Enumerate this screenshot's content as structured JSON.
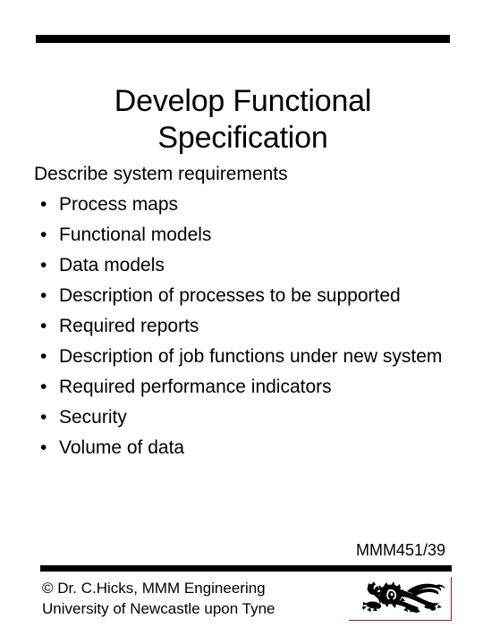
{
  "slide": {
    "title_lines": [
      "Develop Functional",
      "Specification"
    ],
    "lead": "Describe system requirements",
    "bullet_marker": "•",
    "bullets": [
      "Process maps",
      "Functional models",
      "Data models",
      "Description of processes to be supported",
      "Required reports",
      "Description of job functions under new system",
      "Required performance indicators",
      "Security",
      "Volume of data"
    ],
    "slide_number": "MMM451/39",
    "footer": {
      "line1": "© Dr. C.Hicks, MMM Engineering",
      "line2": "University of Newcastle upon Tyne"
    },
    "logo": {
      "name": "newcastle-university-lion-crest",
      "border_color": "#8c2020",
      "fill_color": "#000000"
    },
    "colors": {
      "background": "#ffffff",
      "text": "#000000",
      "rule": "#000000",
      "logo_border": "#8c2020"
    }
  }
}
